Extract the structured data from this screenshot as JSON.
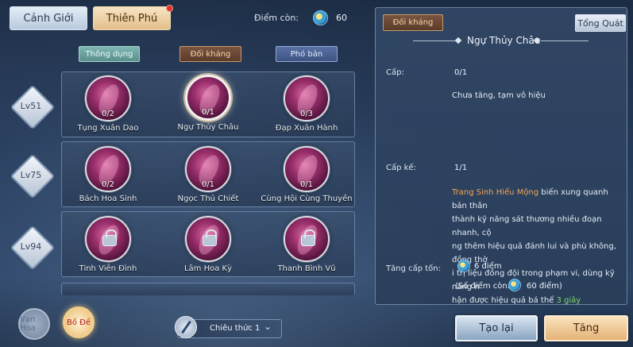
{
  "tabs": {
    "realm": "Cảnh Giới",
    "talent": "Thiên Phú"
  },
  "points": {
    "label": "Điểm còn:",
    "value": "60"
  },
  "categories": {
    "common": "Thông dụng",
    "counter": "Đối kháng",
    "instance": "Phó bản"
  },
  "levels": [
    "Lv51",
    "Lv75",
    "Lv94"
  ],
  "rows": [
    [
      {
        "name": "Tụng Xuân Dao",
        "count": "0/2"
      },
      {
        "name": "Ngự Thủy Châu",
        "count": "0/1"
      },
      {
        "name": "Đạp Xuân Hành",
        "count": "0/3"
      }
    ],
    [
      {
        "name": "Bách Hoa Sinh",
        "count": "0/2"
      },
      {
        "name": "Ngọc Thủ Chiết",
        "count": "0/1"
      },
      {
        "name": "Cùng Hội Cùng Thuyền",
        "count": "0/1"
      }
    ],
    [
      {
        "name": "Tinh Viễn Đình",
        "count": ""
      },
      {
        "name": "Lâm Hoa Kỳ",
        "count": ""
      },
      {
        "name": "Thanh Bình Vũ",
        "count": ""
      }
    ]
  ],
  "schools": {
    "a": "Vạn Hoa",
    "b": "Bồ Đề"
  },
  "plan": {
    "label": "Chiêu thức 1"
  },
  "panel": {
    "tag": "Đối kháng",
    "overview": "Tổng Quát",
    "title": "Ngự Thủy Châu",
    "level_label": "Cấp:",
    "level_value": "0/1",
    "status": "Chưa tăng, tạm vô hiệu",
    "next_label": "Cấp kế:",
    "next_value": "1/1",
    "desc_highlight": "Trang Sinh Hiểu Mộng",
    "desc_lines": [
      " biến xung quanh bản thân",
      "thành kỹ năng sát thương nhiều đoạn nhanh, cộ",
      "ng thêm hiệu quả đánh lui và phù không, đồng thờ",
      "i trị liệu đồng đội trong phạm vi, dùng kỹ năng n",
      "hận được hiệu quả bá thể "
    ],
    "desc_duration": "3 giây",
    "cost_label": "Tăng cấp tốn:",
    "cost_value": "6 điểm",
    "remaining_prefix": "(Số điểm còn:",
    "remaining_value": "60 điểm)"
  },
  "buttons": {
    "reset": "Tạo lại",
    "upgrade": "Tăng"
  }
}
